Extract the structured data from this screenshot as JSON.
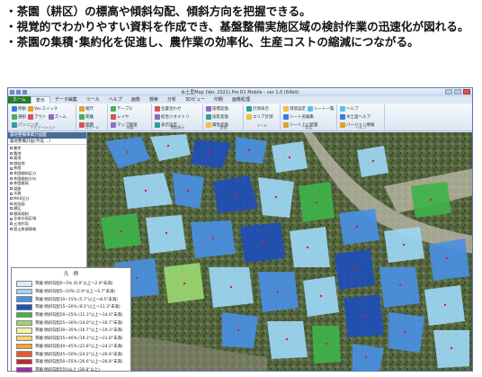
{
  "bullets": [
    "・茶園（耕区）の標高や傾斜勾配、傾斜方向を把握できる。",
    "・視覚的でわかりやすい資料を作成でき、基盤整備実施区域の検討作業の迅速化が図れる。",
    "・茶園の集積･集約化を促進し、農作業の効率化、生産コストの縮減につながる。"
  ],
  "window": {
    "title": "水土里Map (Ver. 2021) Pro R1 Mobile - ver 1.0 (64bit)",
    "tabs": [
      "ホーム",
      "表示",
      "データ編集",
      "ツール",
      "ヘルプ",
      "画像",
      "検索",
      "分析",
      "3Dビュー",
      "印刷",
      "画像処理"
    ],
    "active_tab": "表示",
    "ribbon_groups": [
      {
        "name": "ナビゲーション",
        "items": [
          "移動",
          "Ver.スイッチ",
          "選択",
          "アウト",
          "ズーム",
          "パンニング"
        ]
      },
      {
        "name": "スケール",
        "items": [
          "縮尺",
          "距離",
          "面積"
        ]
      },
      {
        "name": "地図",
        "items": [
          "テーブル",
          "レイヤ",
          "マップ管理"
        ]
      },
      {
        "name": "地図表示",
        "items": [
          "位置合わせ",
          "結合ジオメトリ",
          "表示設定"
        ]
      },
      {
        "name": "変換",
        "items": [
          "座標変換",
          "投影変換",
          "属性変換"
        ]
      },
      {
        "name": "ツール",
        "items": [
          "計測表示",
          "エリア計測"
        ]
      },
      {
        "name": "設定",
        "items": [
          "環境設定",
          "シート一覧",
          "シート名編集",
          "シート上に配置"
        ]
      },
      {
        "name": "ヘルプ",
        "items": [
          "ヘルプ",
          "水土里ヘルプ",
          "バージョン情報"
        ]
      }
    ]
  },
  "panel": {
    "header": "農地整備事業計画図",
    "subheader": "農地整備計画(平成 ...)",
    "tree": [
      "属性",
      "農地",
      "畑地",
      "傾斜地",
      "茶園",
      "茶園傾斜区分",
      "茶園傾斜方向",
      "茶園標高",
      "道路",
      "水路",
      "MAX区分",
      "地形図",
      "耕区",
      "標高傾斜",
      "全体計画区域",
      "土地利用",
      "国土数値情報"
    ]
  },
  "legend": {
    "title": "凡　例",
    "items": [
      {
        "label": "茶園 傾斜勾配0~5% (0.0°以上～2.9°未満)",
        "color": "#d6eefb"
      },
      {
        "label": "茶園 傾斜勾配5~10% (2.9°以上～5.7°未満)",
        "color": "#9dd7f5"
      },
      {
        "label": "茶園 傾斜勾配10~15% (5.7°以上～8.5°未満)",
        "color": "#4a90e2"
      },
      {
        "label": "茶園 傾斜勾配15~20% (8.5°以上～11.3°未満)",
        "color": "#1f4fb8"
      },
      {
        "label": "茶園 傾斜勾配20~25% (11.3°以上～14.0°未満)",
        "color": "#3fb34a"
      },
      {
        "label": "茶園 傾斜勾配25~30% (14.0°以上～16.7°未満)",
        "color": "#9bd770"
      },
      {
        "label": "茶園 傾斜勾配30~35% (16.7°以上～19.3°未満)",
        "color": "#f7f2a8"
      },
      {
        "label": "茶園 傾斜勾配35~40% (19.3°以上～21.8°未満)",
        "color": "#f9d36a"
      },
      {
        "label": "茶園 傾斜勾配40~45% (21.8°以上～24.2°未満)",
        "color": "#f4a23a"
      },
      {
        "label": "茶園 傾斜勾配45~50% (24.2°以上～26.6°未満)",
        "color": "#e85a2c"
      },
      {
        "label": "茶園 傾斜勾配50~55% (26.6°以上～28.8°未満)",
        "color": "#c9232c"
      },
      {
        "label": "茶園 傾斜勾配55%以上 (28.8°以上)",
        "color": "#9b2fa8"
      }
    ]
  }
}
